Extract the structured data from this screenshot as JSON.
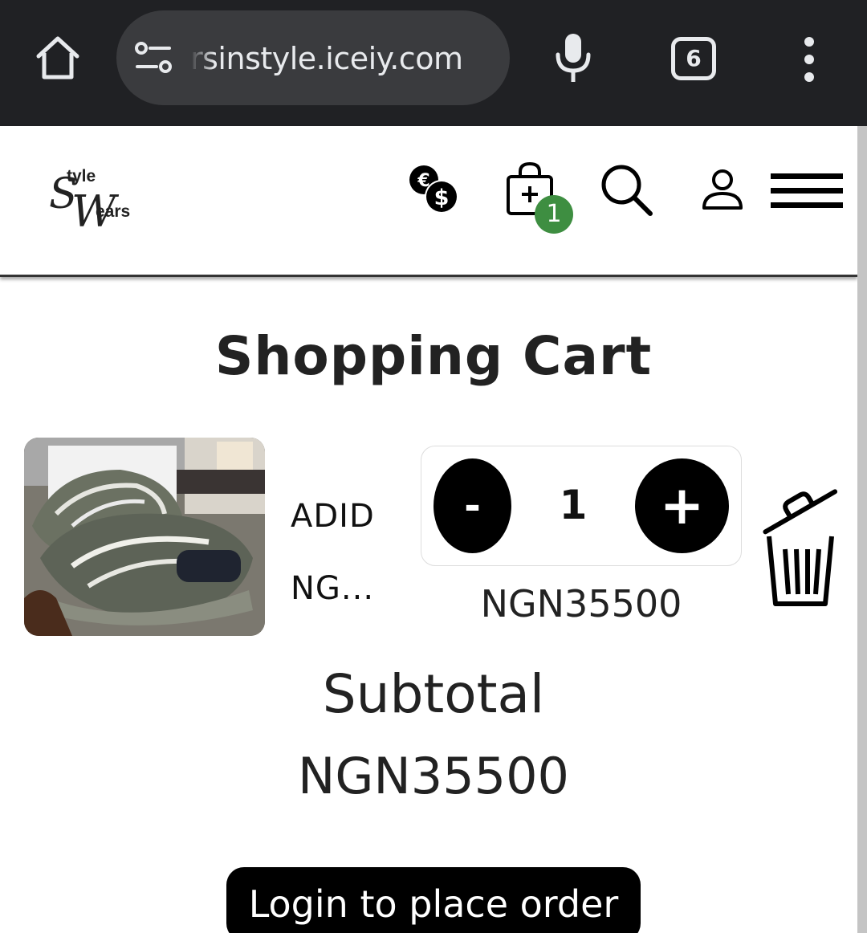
{
  "browser": {
    "url": "rsinstyle.iceiy.com",
    "tab_count": "6"
  },
  "header": {
    "logo": {
      "top_text": "tyle",
      "bottom_text": "ears",
      "initial_s": "S",
      "initial_w": "W"
    },
    "cart_badge": "1",
    "icons": [
      "currency-icon",
      "shopping-bag-icon",
      "search-icon",
      "account-icon",
      "menu-icon"
    ]
  },
  "cart": {
    "title": "Shopping Cart",
    "items": [
      {
        "name": "ADID NG...",
        "quantity": "1",
        "minus_label": "-",
        "plus_label": "+",
        "price": "NGN35500"
      }
    ],
    "subtotal_label": "Subtotal",
    "subtotal_value": "NGN35500",
    "order_button": "Login to place order"
  },
  "colors": {
    "chrome_bg": "#202124",
    "urlbar_bg": "#3a3b3e",
    "badge_green": "#3e8e41",
    "button_black": "#000000"
  }
}
